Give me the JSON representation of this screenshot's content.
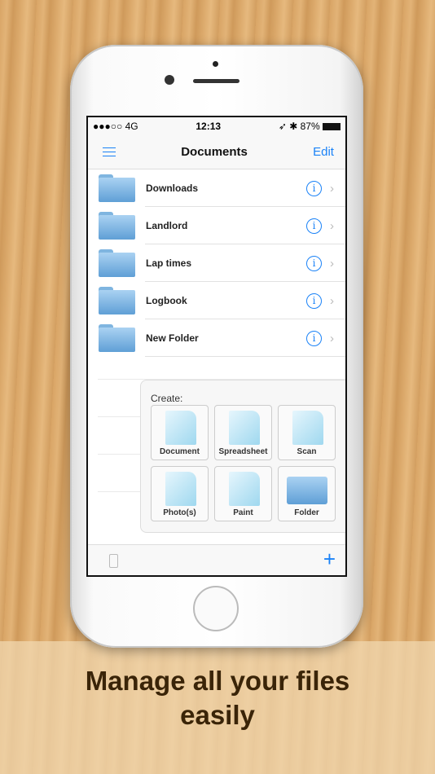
{
  "status": {
    "signal": "●●●○○ 4G",
    "time": "12:13",
    "battery": "87%"
  },
  "nav": {
    "title": "Documents",
    "edit": "Edit"
  },
  "folders": [
    {
      "name": "Downloads"
    },
    {
      "name": "Landlord"
    },
    {
      "name": "Lap times"
    },
    {
      "name": "Logbook"
    },
    {
      "name": "New Folder"
    }
  ],
  "create": {
    "label": "Create:",
    "items": [
      "Document",
      "Spreadsheet",
      "Scan",
      "Photo(s)",
      "Paint",
      "Folder"
    ]
  },
  "caption": "Manage all your files easily",
  "colors": {
    "accent": "#1a82f7",
    "caption": "#3a2408"
  }
}
